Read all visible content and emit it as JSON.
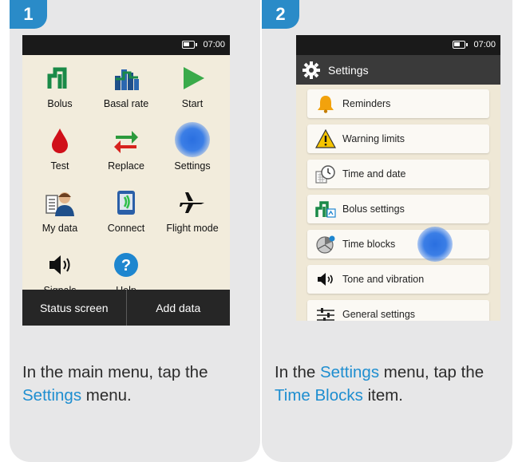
{
  "steps": [
    {
      "number": "1",
      "device": {
        "status_time": "07:00",
        "menu": [
          {
            "label": "Bolus",
            "icon": "bolus-icon"
          },
          {
            "label": "Basal rate",
            "icon": "basal-rate-icon"
          },
          {
            "label": "Start",
            "icon": "play-icon"
          },
          {
            "label": "Test",
            "icon": "blood-drop-icon"
          },
          {
            "label": "Replace",
            "icon": "replace-arrows-icon"
          },
          {
            "label": "Settings",
            "icon": "tap-indicator-icon"
          },
          {
            "label": "My data",
            "icon": "my-data-icon"
          },
          {
            "label": "Connect",
            "icon": "connect-icon"
          },
          {
            "label": "Flight mode",
            "icon": "airplane-icon"
          },
          {
            "label": "Signals",
            "icon": "speaker-icon"
          },
          {
            "label": "Help",
            "icon": "help-icon"
          }
        ],
        "bottom_left": "Status screen",
        "bottom_right": "Add data"
      },
      "caption": {
        "before": "In the main menu, tap the ",
        "highlight": "Settings",
        "after": " menu."
      }
    },
    {
      "number": "2",
      "device": {
        "status_time": "07:00",
        "title": "Settings",
        "items": [
          {
            "label": "Reminders",
            "icon": "bell-icon"
          },
          {
            "label": "Warning limits",
            "icon": "warning-icon"
          },
          {
            "label": "Time and date",
            "icon": "clock-calendar-icon"
          },
          {
            "label": "Bolus settings",
            "icon": "bolus-settings-icon"
          },
          {
            "label": "Time blocks",
            "icon": "time-blocks-icon"
          },
          {
            "label": "Tone and vibration",
            "icon": "speaker-icon"
          },
          {
            "label": "General settings",
            "icon": "sliders-icon"
          }
        ]
      },
      "caption": {
        "before": "In the ",
        "highlight": "Settings",
        "middle": " menu, tap the ",
        "highlight2": "Time Blocks",
        "after": " item."
      }
    }
  ],
  "colors": {
    "accent": "#2a8bc8",
    "highlight_text": "#1e8ed0",
    "card_bg": "#e7e7e8"
  }
}
